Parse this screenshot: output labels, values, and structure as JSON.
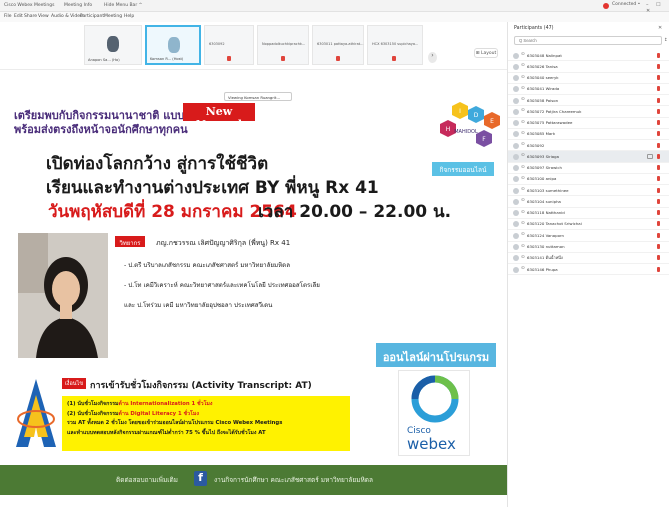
{
  "titlebar": {
    "app_title": "Cisco Webex Meetings",
    "meeting_info": "Meeting Info",
    "hide_menu": "Hide Menu Bar ^",
    "connection": "Connected •",
    "window_controls": "– ☐ ✕"
  },
  "menubar": [
    "File",
    "Edit",
    "Share",
    "View",
    "Audio & Video",
    "Participant",
    "Meeting",
    "Help"
  ],
  "video_strip": {
    "thumbs": [
      {
        "name": "Anapon Sa... (Ho)"
      },
      {
        "name": "Komsan R... (Host)"
      },
      {
        "label": "6303092"
      },
      {
        "label": "Noppadolkuchkiprachk..."
      },
      {
        "label": "6303011 pattaya-athirat..."
      },
      {
        "label": "HCX 6303150 supichaya..."
      }
    ],
    "next": "›",
    "layout_button": "⊞ Layout"
  },
  "viewing_tip": "Viewing Komsan Ruangrit...",
  "slide": {
    "top_line1": "เตรียมพบกับกิจกรรมนานาชาติ แบบ",
    "top_line2": "พร้อมส่งตรงถึงหน้าจอนักศึกษาทุกคน",
    "badge": "New Normal",
    "headline1": "เปิดท่องโลกกว้าง สู่การใช้ชีวิต",
    "headline2": "เรียนและทำงานต่างประเทศ BY พี่หนู Rx 41",
    "date": "วันพฤหัสบดีที่ 28 มกราคม 2564",
    "time": "เวลา 20.00 – 22.00 น.",
    "logo_letters": [
      "I",
      "D",
      "E",
      "H",
      "F"
    ],
    "logo_caption": "MAHIDOL",
    "logo_sub": "กิจกรรมออนไลน์",
    "speaker_tag": "วิทยากร",
    "speaker_name": "ภญ.กชวรรณ เลิศปัญญาศิริกุล (พี่หนู) Rx 41",
    "speaker_lines": [
      "- ป.ตรี บริบาลเภสัชกรรม คณะเภสัชศาสตร์ มหาวิทยาลัยมหิดล",
      "- ป.โท เคมีวิเคราะห์ คณะวิทยาศาสตร์และเทคโนโลยี ประเทศออสโตรเลีย",
      "และ ป.โทร่วม เคมี มหาวิทยาลัยอุปซอลา ประเทศสวีเดน"
    ],
    "online_button": "ออนไลน์ผ่านโปรแกรม",
    "at_tag": "เงื่อนไข",
    "at_title": "การเข้ารับชั่วโมงกิจกรรม (Activity Transcript: AT)",
    "at_lines": [
      {
        "pre": "(1) นับชั่วโมงกิจกรรม",
        "hl": "ด้าน Internationalization 1 ชั่วโมง",
        "post": ""
      },
      {
        "pre": "(2) นับชั่วโมงกิจกรรม",
        "hl": "ด้าน Digital Literacy 1 ชั่วโมง",
        "post": ""
      },
      {
        "pre": "รวม AT ทั้งหมด 2 ชั่วโมง โดยขอเข้าร่วมออนไลน์ผ่านโปรแกรม Cisco Webex Meetings",
        "hl": "",
        "post": ""
      },
      {
        "pre": "และทำแบบทดสอบหลังกิจกรรมผ่านเกณฑ์ไม่ต่ำกว่า 75 % ขึ้นไป ถึงจะได้รับชั่วโมง AT",
        "hl": "",
        "post": ""
      }
    ],
    "webex_brand1": "Cisco",
    "webex_brand2": "webex",
    "footer_text1": "ติดต่อสอบถามเพิ่มเติม",
    "footer_fb": "f",
    "footer_text2": "งานกิจการนักศึกษา คณะเภสัชศาสตร์ มหาวิทยาลัยมหิดล"
  },
  "participants": {
    "header": "Participants (47)",
    "close": "✕",
    "search_placeholder": "Q Search",
    "sort": "↕",
    "items": [
      {
        "name": "6303048 Nalinpat"
      },
      {
        "name": "6303026 Tanisa"
      },
      {
        "name": "6303040 seeryk"
      },
      {
        "name": "6303041 Wirada"
      },
      {
        "name": "6303058 Paison"
      },
      {
        "name": "6303072 Patjira Chareemuk"
      },
      {
        "name": "6303075 Pattarawadee"
      },
      {
        "name": "6303085 Mark"
      },
      {
        "name": "6303092"
      },
      {
        "name": "6303093 Siriaga"
      },
      {
        "name": "6303097 Sirawich"
      },
      {
        "name": "6303100 anipa"
      },
      {
        "name": "6303103 sumethinee"
      },
      {
        "name": "6303104 sunipha"
      },
      {
        "name": "6303118 Natthanid"
      },
      {
        "name": "6303120 Tanachot Sriwichai"
      },
      {
        "name": "6303124 Vanaporn"
      },
      {
        "name": "6303130 nuttamon"
      },
      {
        "name": "6303141 ต้นน้ำหนึ่ง"
      },
      {
        "name": "6303146 Phupa"
      }
    ]
  },
  "colors": {
    "brand_red": "#d81b1b",
    "accent_blue": "#58b6e0",
    "footer_green": "#4c7a34",
    "highlight_yellow": "#fff200",
    "mic_muted": "#e0453c"
  }
}
